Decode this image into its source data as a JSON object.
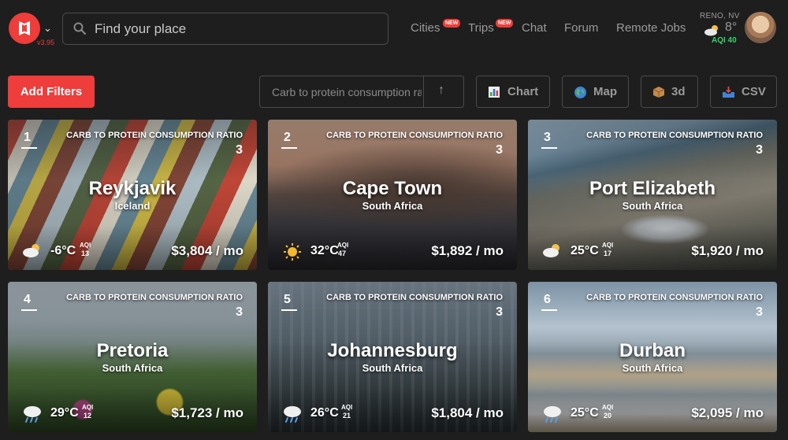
{
  "header": {
    "version": "v3.95",
    "search_placeholder": "Find your place",
    "nav": [
      {
        "label": "Cities",
        "badge": "NEW"
      },
      {
        "label": "Trips",
        "badge": "NEW"
      },
      {
        "label": "Chat"
      },
      {
        "label": "Forum"
      },
      {
        "label": "Remote Jobs"
      }
    ],
    "weather": {
      "location": "RENO, NV",
      "temp": "8°",
      "aqi": "AQI 40",
      "icon": "partly-cloudy-icon"
    }
  },
  "toolbar": {
    "add_filters": "Add Filters",
    "sort_label": "Carb to protein consumption ratio",
    "sort_arrow": "↑",
    "buttons": [
      {
        "label": "Chart",
        "icon": "bar-chart-icon"
      },
      {
        "label": "Map",
        "icon": "globe-icon"
      },
      {
        "label": "3d",
        "icon": "box-icon"
      },
      {
        "label": "CSV",
        "icon": "inbox-tray-icon"
      }
    ]
  },
  "metric_label": "CARB TO PROTEIN CONSUMPTION RATIO",
  "aqi_label": "AQI",
  "cards": [
    {
      "rank": "1",
      "city": "Reykjavik",
      "country": "Iceland",
      "value": "3",
      "temp": "-6°C",
      "aqi": "13",
      "price": "$3,804 / mo",
      "weather_icon": "partly-cloudy-icon"
    },
    {
      "rank": "2",
      "city": "Cape Town",
      "country": "South Africa",
      "value": "3",
      "temp": "32°C",
      "aqi": "47",
      "price": "$1,892 / mo",
      "weather_icon": "sun-icon"
    },
    {
      "rank": "3",
      "city": "Port Elizabeth",
      "country": "South Africa",
      "value": "3",
      "temp": "25°C",
      "aqi": "17",
      "price": "$1,920 / mo",
      "weather_icon": "partly-cloudy-icon"
    },
    {
      "rank": "4",
      "city": "Pretoria",
      "country": "South Africa",
      "value": "3",
      "temp": "29°C",
      "aqi": "12",
      "price": "$1,723 / mo",
      "weather_icon": "rain-cloud-icon"
    },
    {
      "rank": "5",
      "city": "Johannesburg",
      "country": "South Africa",
      "value": "3",
      "temp": "26°C",
      "aqi": "21",
      "price": "$1,804 / mo",
      "weather_icon": "rain-cloud-icon"
    },
    {
      "rank": "6",
      "city": "Durban",
      "country": "South Africa",
      "value": "3",
      "temp": "25°C",
      "aqi": "20",
      "price": "$2,095 / mo",
      "weather_icon": "rain-cloud-icon"
    }
  ],
  "colors": {
    "brand": "#ee3d3a",
    "aqi_good": "#36d36a",
    "background": "#1e1e1e"
  }
}
